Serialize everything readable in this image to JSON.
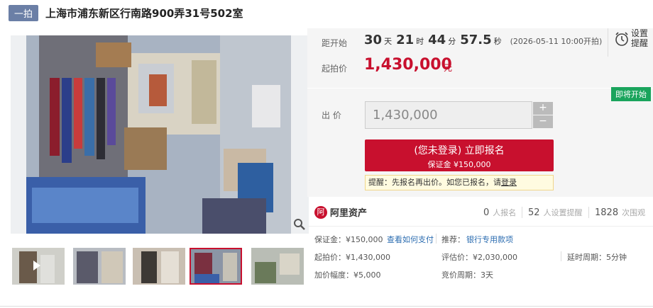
{
  "header": {
    "tag": "一拍",
    "title": "上海市浦东新区行南路900弄31号502室"
  },
  "countdown": {
    "label": "距开始",
    "days": "30",
    "days_unit": "天",
    "hours": "21",
    "hours_unit": "时",
    "minutes": "44",
    "minutes_unit": "分",
    "seconds": "57.5",
    "seconds_unit": "秒",
    "start_note": "(2026-05-11 10:00开拍)"
  },
  "remind": {
    "label": "设置提醒",
    "icon": "alarm-clock-icon"
  },
  "start_price": {
    "label": "起拍价",
    "value": "1,430,000",
    "unit": "元"
  },
  "bid": {
    "badge": "即将开始",
    "label": "出 价",
    "value": "1,430,000",
    "plus": "+",
    "minus": "−",
    "signup_main": "(您未登录) 立即报名",
    "signup_sub": "保证金 ¥150,000",
    "notice_text": "提醒：先报名再出价。如您已报名，请",
    "notice_link": "登录"
  },
  "stats": {
    "logo_icon": "阿",
    "logo_text": "阿里资产",
    "signups": "0",
    "signups_label": "人报名",
    "reminders": "52",
    "reminders_label": "人设置提醒",
    "views": "1828",
    "views_label": "次围观"
  },
  "details": {
    "deposit": "保证金：¥150,000",
    "deposit_link": "查看如何支付",
    "recommend_label": "推荐：",
    "recommend_link": "银行专用款项",
    "start_price": "起拍价：¥1,430,000",
    "eval_price": "评估价：¥2,030,000",
    "delay": "延时周期：5分钟",
    "increment": "加价幅度：¥5,000",
    "cycle": "竞价周期：3天"
  },
  "colors": {
    "accent_red": "#c8102e",
    "badge_green": "#1aa45c",
    "tag_blue": "#6b7fa6",
    "link_blue": "#2b6cb0"
  }
}
